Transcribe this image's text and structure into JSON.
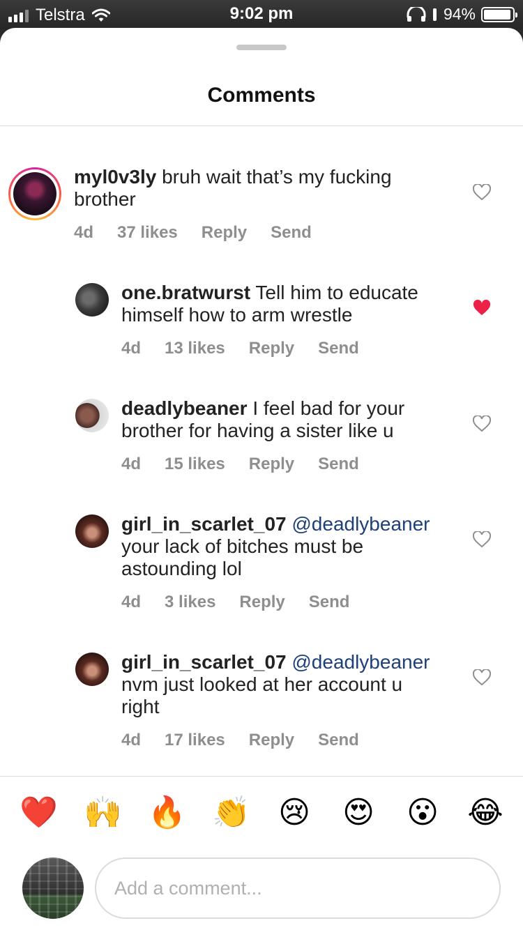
{
  "status_bar": {
    "carrier": "Telstra",
    "time": "9:02 pm",
    "battery_percent": "94%"
  },
  "sheet": {
    "title": "Comments"
  },
  "comments": [
    {
      "username": "myl0v3ly",
      "text": "bruh wait that’s my fucking brother",
      "mention": "",
      "age": "4d",
      "likes": "37 likes",
      "reply_label": "Reply",
      "send_label": "Send",
      "liked": false
    },
    {
      "username": "one.bratwurst",
      "text": "Tell him to educate himself how to arm wrestle",
      "mention": "",
      "age": "4d",
      "likes": "13 likes",
      "reply_label": "Reply",
      "send_label": "Send",
      "liked": true
    },
    {
      "username": "deadlybeaner",
      "text": "I feel bad for your brother for having a sister like u",
      "mention": "",
      "age": "4d",
      "likes": "15 likes",
      "reply_label": "Reply",
      "send_label": "Send",
      "liked": false
    },
    {
      "username": "girl_in_scarlet_07",
      "mention": "@deadlybeaner",
      "text": "your lack of bitches must be astounding lol",
      "age": "4d",
      "likes": "3 likes",
      "reply_label": "Reply",
      "send_label": "Send",
      "liked": false
    },
    {
      "username": "girl_in_scarlet_07",
      "mention": "@deadlybeaner",
      "text": "nvm just looked at her account u right",
      "age": "4d",
      "likes": "17 likes",
      "reply_label": "Reply",
      "send_label": "Send",
      "liked": false
    }
  ],
  "emoji_bar": [
    "❤️",
    "🙌",
    "🔥",
    "👏",
    "😢",
    "😍",
    "😮",
    "😂"
  ],
  "composer": {
    "placeholder": "Add a comment..."
  },
  "colors": {
    "liked_heart": "#ed2048",
    "mention": "#1d3f7a",
    "meta_text": "#8e8e8e"
  }
}
